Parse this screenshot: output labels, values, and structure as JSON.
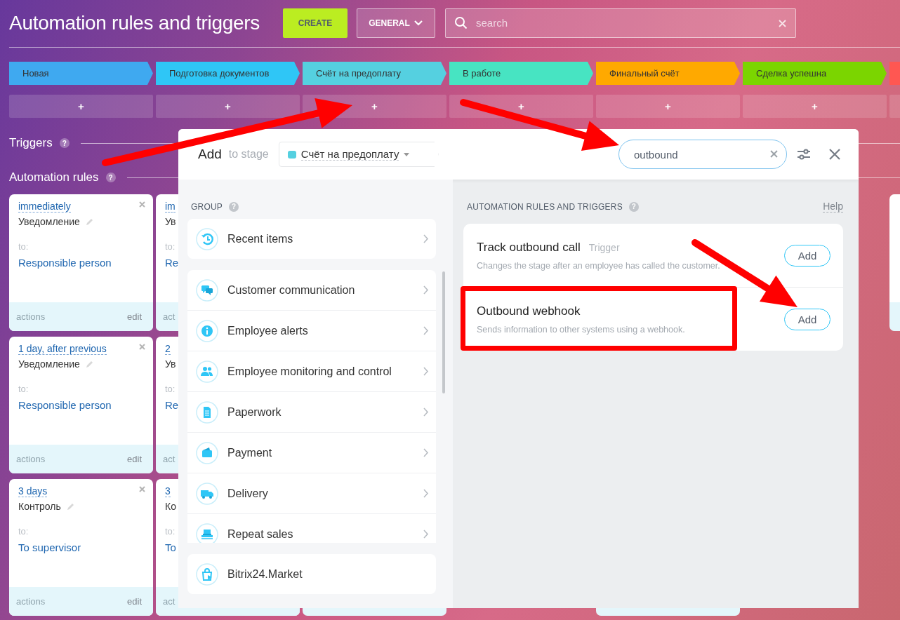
{
  "page": {
    "title": "Automation rules and triggers",
    "create_button": "CREATE",
    "category_button": "GENERAL",
    "search": {
      "placeholder": "search"
    }
  },
  "stages": [
    {
      "name": "Новая",
      "color": "#3fa9f0",
      "add_label": "+"
    },
    {
      "name": "Подготовка документов",
      "color": "#2fc6f6",
      "add_label": "+"
    },
    {
      "name": "Счёт на предоплату",
      "color": "#55d0e0",
      "add_label": "+"
    },
    {
      "name": "В работе",
      "color": "#47e4c2",
      "add_label": "+"
    },
    {
      "name": "Финальный счёт",
      "color": "#ffa900",
      "add_label": "+"
    },
    {
      "name": "Сделка успешна",
      "color": "#7bd500",
      "add_label": "+"
    },
    {
      "color": "#ff5752"
    }
  ],
  "sections": [
    {
      "title": "Triggers",
      "help": "?"
    },
    {
      "title": "Automation rules",
      "help": "?"
    }
  ],
  "rule_columns": [
    {
      "cards": [
        {
          "kind": "rule",
          "delay": "immediately",
          "name": "Уведомление",
          "to_label": "to:",
          "recipient": "Responsible person",
          "footer_label": "actions",
          "edit_label": "edit"
        },
        {
          "kind": "rule",
          "delay": "1 day, after previous",
          "name": "Уведомление",
          "to_label": "to:",
          "recipient": "Responsible person",
          "footer_label": "actions",
          "edit_label": "edit"
        },
        {
          "kind": "rule",
          "delay": "3 days",
          "name": "Контроль",
          "to_label": "to:",
          "recipient": "To supervisor",
          "footer_label": "actions",
          "edit_label": "edit"
        }
      ]
    },
    {
      "cards": [
        {
          "kind": "partial",
          "delay": "im",
          "name": "Ув",
          "to_label": "to:",
          "recipient": "Re",
          "footer_label": "act"
        },
        {
          "kind": "partial",
          "delay": "2",
          "name": "Ув",
          "to_label": "to:",
          "recipient": "Re",
          "footer_label": "act"
        },
        {
          "kind": "partial",
          "delay": "3",
          "name": "Ко",
          "to_label": "to:",
          "recipient": "To",
          "footer_label": "act"
        }
      ]
    },
    {
      "cards": [
        {
          "kind": "gap"
        },
        {
          "kind": "gap"
        },
        {
          "kind": "blank"
        }
      ]
    },
    {},
    {
      "cards": [
        {
          "kind": "gap"
        },
        {
          "kind": "gap"
        },
        {
          "kind": "blank"
        }
      ]
    },
    {},
    {
      "cards": [
        {
          "kind": "blank"
        }
      ]
    }
  ],
  "modal": {
    "title": "Add",
    "subtitle": "to stage",
    "stage": {
      "name": "Счёт на предоплату",
      "color": "#55d0e0"
    },
    "search": {
      "value": "outbound"
    },
    "group_heading": "GROUP",
    "group_help": "?",
    "recent": {
      "label": "Recent items"
    },
    "groups": [
      {
        "label": "Customer communication"
      },
      {
        "label": "Employee alerts"
      },
      {
        "label": "Employee monitoring and control"
      },
      {
        "label": "Paperwork"
      },
      {
        "label": "Payment"
      },
      {
        "label": "Delivery"
      },
      {
        "label": "Repeat sales"
      }
    ],
    "market": {
      "label": "Bitrix24.Market"
    },
    "results_heading": "AUTOMATION RULES AND TRIGGERS",
    "results_help": "?",
    "help_link": "Help",
    "results": [
      {
        "title": "Track outbound call",
        "tag": "Trigger",
        "description": "Changes the stage after an employee has called the customer.",
        "button": "Add",
        "highlighted": false
      },
      {
        "title": "Outbound webhook",
        "description": "Sends information to other systems using a webhook.",
        "button": "Add",
        "highlighted": true
      }
    ]
  }
}
